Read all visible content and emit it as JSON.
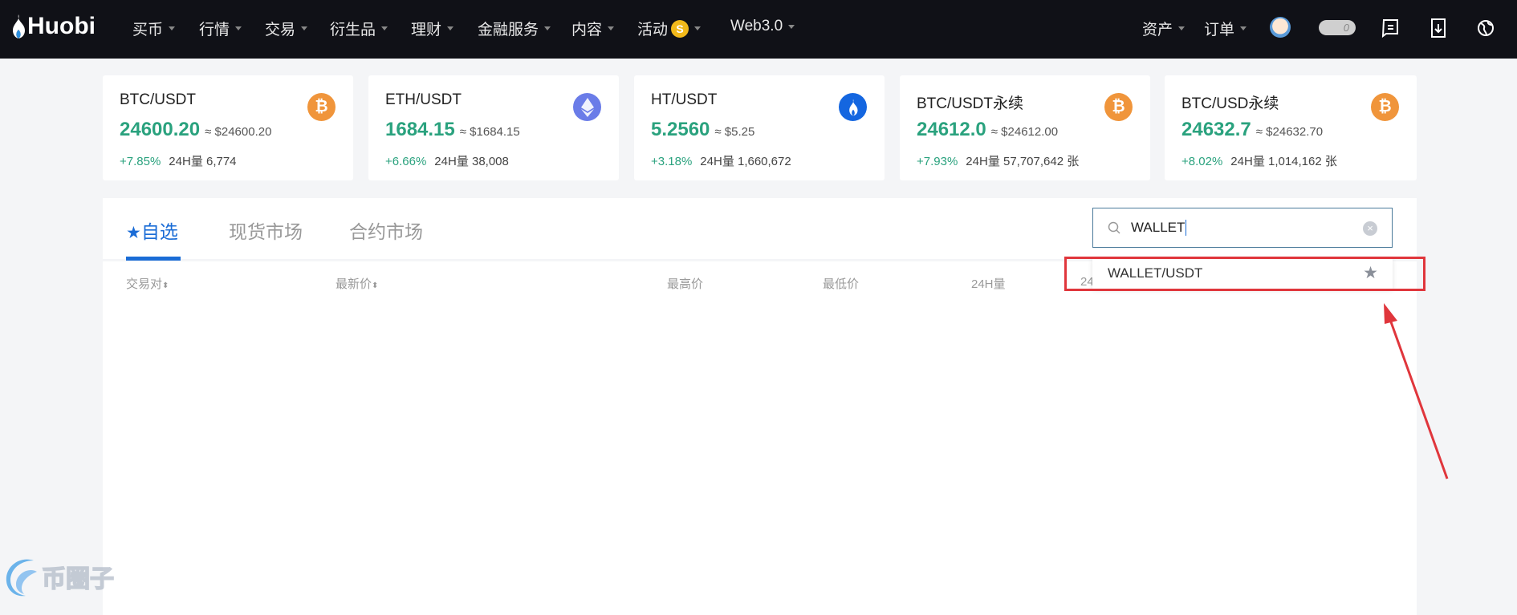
{
  "nav": {
    "logo": "Huobi",
    "items": [
      "买币",
      "行情",
      "交易",
      "衍生品",
      "理财",
      "金融服务",
      "内容",
      "活动",
      "Web3.0"
    ],
    "activity_badge": "S",
    "right": [
      "资产",
      "订单"
    ],
    "toggle_count": "0"
  },
  "cards": [
    {
      "pair": "BTC/USDT",
      "price": "24600.20",
      "usd": "≈ $24600.20",
      "change": "+7.85%",
      "volume": "24H量 6,774",
      "icon": "bitcoin-icon",
      "color": "#f0953b"
    },
    {
      "pair": "ETH/USDT",
      "price": "1684.15",
      "usd": "≈ $1684.15",
      "change": "+6.66%",
      "volume": "24H量 38,008",
      "icon": "ethereum-icon",
      "color": "#6a7ce8"
    },
    {
      "pair": "HT/USDT",
      "price": "5.2560",
      "usd": "≈ $5.25",
      "change": "+3.18%",
      "volume": "24H量 1,660,672",
      "icon": "huobi-token-icon",
      "color": "#1466e0"
    },
    {
      "pair": "BTC/USDT永续",
      "price": "24612.0",
      "usd": "≈ $24612.00",
      "change": "+7.93%",
      "volume": "24H量 57,707,642 张",
      "icon": "bitcoin-icon",
      "color": "#f0953b"
    },
    {
      "pair": "BTC/USD永续",
      "price": "24632.7",
      "usd": "≈ $24632.70",
      "change": "+8.02%",
      "volume": "24H量 1,014,162 张",
      "icon": "bitcoin-icon",
      "color": "#f0953b"
    }
  ],
  "tabs": [
    "自选",
    "现货市场",
    "合约市场"
  ],
  "columns": [
    "交易对",
    "最新价",
    "最高价",
    "最低价",
    "24H量",
    "24"
  ],
  "search": {
    "value": "WALLET",
    "result": "WALLET/USDT"
  },
  "watermark": "币圈子",
  "colors": {
    "accent": "#1a6cd6",
    "up": "#2aa27e",
    "highlight": "#e0363c"
  }
}
